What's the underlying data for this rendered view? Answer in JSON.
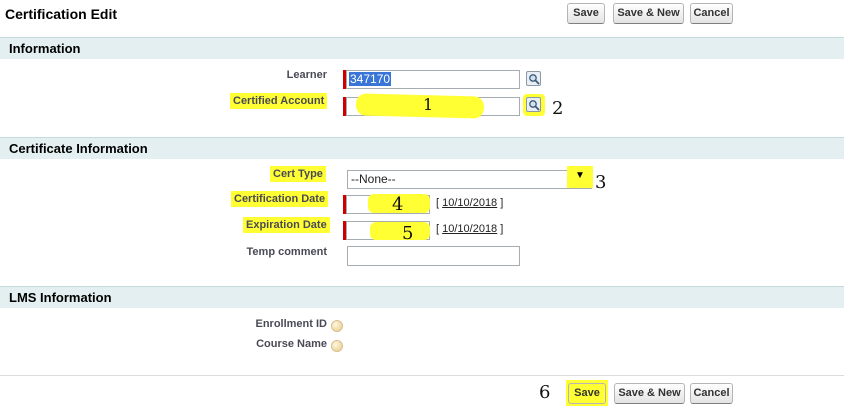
{
  "header": {
    "title": "Certification Edit",
    "buttons": {
      "save": "Save",
      "save_new": "Save & New",
      "cancel": "Cancel"
    }
  },
  "sections": {
    "information": "Information",
    "certificate_information": "Certificate Information",
    "lms_information": "LMS Information"
  },
  "fields": {
    "learner": {
      "label": "Learner",
      "value": "347170"
    },
    "certified_account": {
      "label": "Certified Account",
      "value": ""
    },
    "cert_type": {
      "label": "Cert Type",
      "value": "--None--"
    },
    "certification_date": {
      "label": "Certification Date",
      "value": "",
      "today_link": "10/10/2018"
    },
    "expiration_date": {
      "label": "Expiration Date",
      "value": "",
      "today_link": "10/10/2018"
    },
    "temp_comment": {
      "label": "Temp comment",
      "value": ""
    },
    "enrollment_id": {
      "label": "Enrollment ID"
    },
    "course_name": {
      "label": "Course Name"
    }
  },
  "footer": {
    "buttons": {
      "save": "Save",
      "save_new": "Save & New",
      "cancel": "Cancel"
    }
  },
  "annotations": {
    "step_1": "1",
    "step_2": "2",
    "step_3": "3",
    "step_4": "4",
    "step_5": "5",
    "step_6": "6"
  },
  "colors": {
    "highlight": "#ffff33",
    "section_bg": "#e3eff0",
    "required": "#cc0000"
  },
  "icons": [
    "lookup-icon",
    "dropdown-arrow-icon",
    "info-icon"
  ]
}
